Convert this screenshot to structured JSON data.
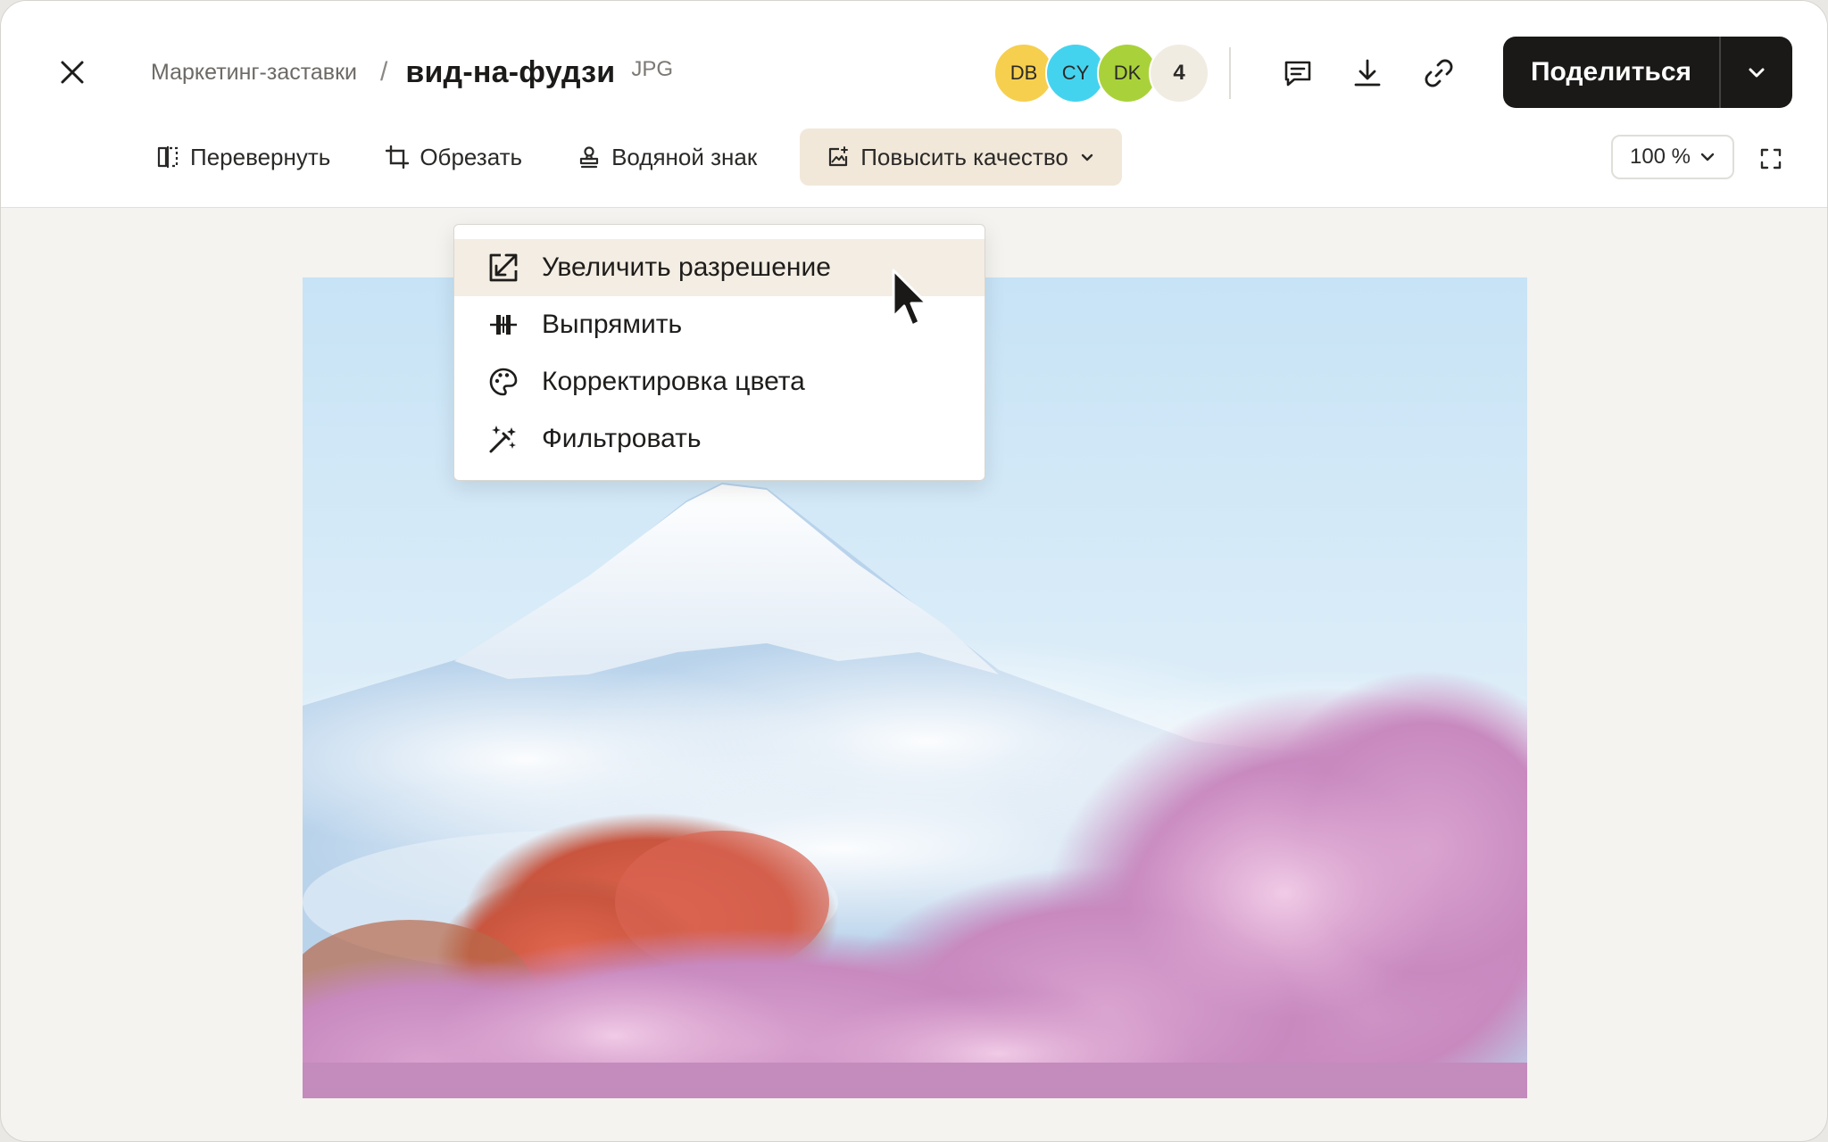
{
  "header": {
    "breadcrumb_parent": "Маркетинг-заставки",
    "separator": "/",
    "file_name": "вид-на-фудзи",
    "file_ext": "JPG"
  },
  "collaborators": {
    "avatars": [
      "DB",
      "CY",
      "DK"
    ],
    "more_count": "4"
  },
  "actions": {
    "comment_icon": "comment-icon",
    "download_icon": "download-icon",
    "link_icon": "link-icon",
    "share_label": "Поделиться"
  },
  "toolbar": {
    "flip_label": "Перевернуть",
    "crop_label": "Обрезать",
    "watermark_label": "Водяной знак",
    "enhance_label": "Повысить качество",
    "zoom_value": "100 %"
  },
  "enhance_menu": {
    "items": [
      {
        "label": "Увеличить разрешение",
        "icon": "upscale-icon"
      },
      {
        "label": "Выпрямить",
        "icon": "straighten-icon"
      },
      {
        "label": "Корректировка цвета",
        "icon": "palette-icon"
      },
      {
        "label": "Фильтровать",
        "icon": "magic-wand-icon"
      }
    ]
  },
  "colors": {
    "accent_dark": "#1a1918",
    "active_tool_bg": "#f1e8da",
    "avatar_db": "#f6cf4e",
    "avatar_cy": "#44d3ef",
    "avatar_dk": "#a9d23a"
  }
}
